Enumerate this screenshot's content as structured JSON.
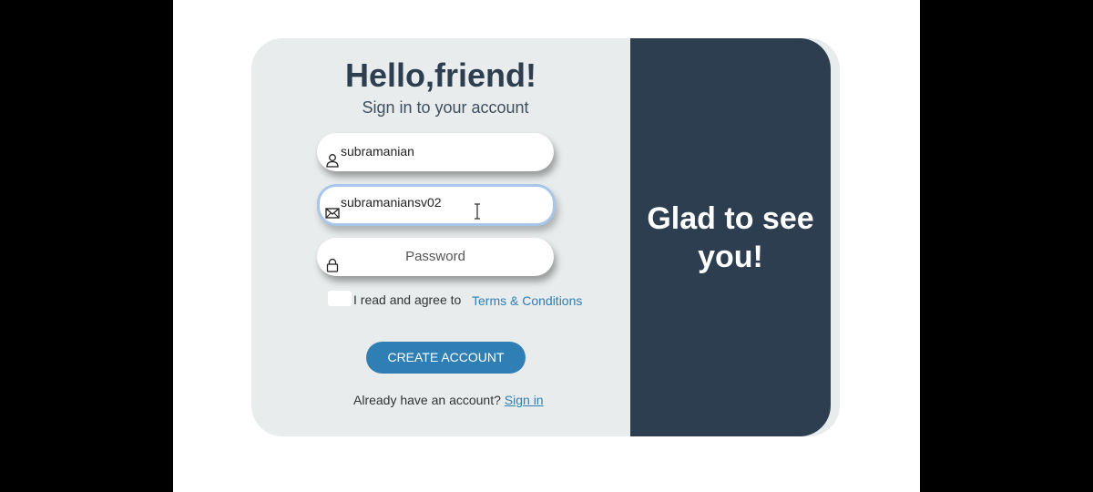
{
  "form": {
    "title": "Hello,friend!",
    "subtitle": "Sign in to your account",
    "username_value": "subramanian",
    "email_value": "subramaniansv02",
    "password_placeholder": "Password",
    "agree_text": "I read and agree to",
    "terms_link": "Terms & Conditions",
    "create_button": "CREATE ACCOUNT",
    "signin_prompt": "Already have an account?",
    "signin_link": "Sign in"
  },
  "side_panel": {
    "message": "Glad to see you!"
  },
  "icons": {
    "username": "user-icon",
    "email": "envelope-icon",
    "password": "lock-icon"
  },
  "colors": {
    "panel": "#2d3e50",
    "card": "#e8ecec",
    "accent": "#2f7fb5",
    "focus_border": "#a7c6ea"
  }
}
